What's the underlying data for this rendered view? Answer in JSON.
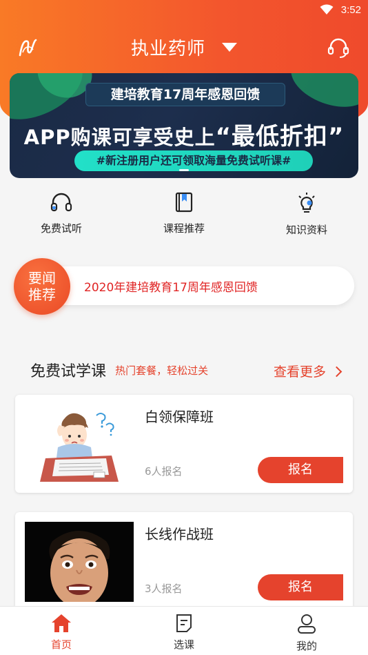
{
  "status_bar": {
    "time": "3:52"
  },
  "header": {
    "title": "执业药师"
  },
  "banner": {
    "top_text": "建培教育17周年感恩回馈",
    "main_prefix": "APP购课可享受史上",
    "main_highlight": "“最低折扣”",
    "sub_text": "#新注册用户还可领取海量免费试听课#"
  },
  "quick_links": [
    {
      "label": "免费试听",
      "icon": "headphones-icon"
    },
    {
      "label": "课程推荐",
      "icon": "book-icon"
    },
    {
      "label": "知识资料",
      "icon": "lightbulb-icon"
    }
  ],
  "news": {
    "badge_line1": "要闻",
    "badge_line2": "推荐",
    "text": "2020年建培教育17周年感恩回馈"
  },
  "free_section": {
    "title": "免费试学课",
    "subtitle": "热门套餐，轻松过关",
    "more": "查看更多"
  },
  "courses": [
    {
      "name": "白领保障班",
      "count": "6人报名",
      "button": "报名"
    },
    {
      "name": "长线作战班",
      "count": "3人报名",
      "button": "报名"
    }
  ],
  "tabs": [
    {
      "label": "首页",
      "icon": "home-icon",
      "active": true
    },
    {
      "label": "选课",
      "icon": "document-icon",
      "active": false
    },
    {
      "label": "我的",
      "icon": "user-icon",
      "active": false
    }
  ],
  "colors": {
    "accent": "#e5432d",
    "header_start": "#f97a26",
    "header_end": "#ef4a2c"
  }
}
